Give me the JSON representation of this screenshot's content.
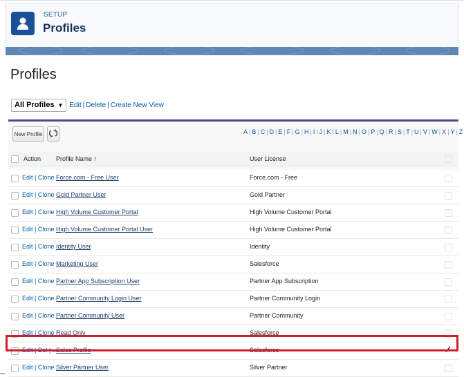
{
  "header": {
    "eyebrow": "SETUP",
    "title": "Profiles",
    "icon": "user-icon"
  },
  "page": {
    "title": "Profiles"
  },
  "view": {
    "selected": "All Profiles",
    "links": [
      "Edit",
      "Delete",
      "Create New View"
    ]
  },
  "toolbar": {
    "new_button": "New Profile",
    "refresh_icon": "refresh-icon"
  },
  "alphabet": [
    "A",
    "B",
    "C",
    "D",
    "E",
    "F",
    "G",
    "H",
    "I",
    "J",
    "K",
    "L",
    "M",
    "N",
    "O",
    "P",
    "Q",
    "R",
    "S",
    "T",
    "U",
    "V",
    "W",
    "X",
    "Y",
    "Z"
  ],
  "table": {
    "columns": [
      "Action",
      "Profile Name ↑",
      "User License"
    ],
    "rows": [
      {
        "action": "Edit | Clone",
        "name": "Force.com - Free User",
        "license": "Force.com - Free",
        "custom": false
      },
      {
        "action": "Edit | Clone",
        "name": "Gold Partner User",
        "license": "Gold Partner",
        "custom": false
      },
      {
        "action": "Edit | Clone",
        "name": "High Volume Customer Portal",
        "license": "High Volume Customer Portal",
        "custom": false
      },
      {
        "action": "Edit | Clone",
        "name": "High Volume Customer Portal User",
        "license": "High Volume Customer Portal",
        "custom": false
      },
      {
        "action": "Edit | Clone",
        "name": "Identity User",
        "license": "Identity",
        "custom": false
      },
      {
        "action": "Edit | Clone",
        "name": "Marketing User",
        "license": "Salesforce",
        "custom": false
      },
      {
        "action": "Edit | Clone",
        "name": "Partner App Subscription User",
        "license": "Partner App Subscription",
        "custom": false
      },
      {
        "action": "Edit | Clone",
        "name": "Partner Community Login User",
        "license": "Partner Community Login",
        "custom": false
      },
      {
        "action": "Edit | Clone",
        "name": "Partner Community User",
        "license": "Partner Community",
        "custom": false
      },
      {
        "action": "Edit | Clone",
        "name": "Read Only",
        "license": "Salesforce",
        "custom": false
      },
      {
        "action": "Edit | Del | ...",
        "name": "Sales Profile",
        "license": "Salesforce",
        "custom": true
      },
      {
        "action": "Edit | Clone",
        "name": "Silver Partner User",
        "license": "Silver Partner",
        "custom": false
      }
    ],
    "check_glyph": "✓"
  },
  "colors": {
    "brand_blue": "#1b5297",
    "link_blue": "#015ba7",
    "list_border": "#56458c",
    "highlight": "#cc1f2f"
  }
}
